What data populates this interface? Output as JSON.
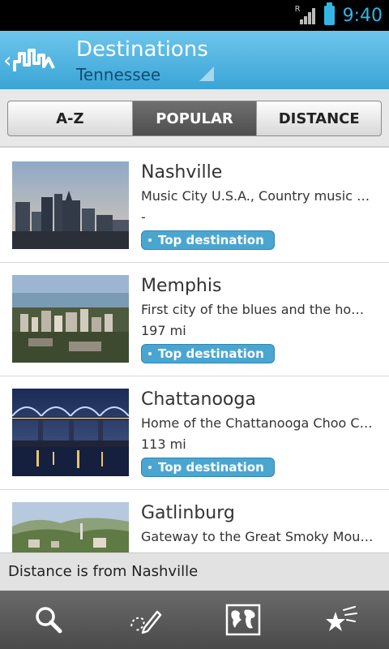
{
  "status_bar": {
    "roaming_indicator": "R",
    "time": "9:40",
    "icons": [
      "signal-icon",
      "battery-icon"
    ]
  },
  "header": {
    "title": "Destinations",
    "subtitle": "Tennessee",
    "icons": [
      "back-chevron-icon",
      "app-logo-icon",
      "dropdown-corner-icon"
    ]
  },
  "tabs": [
    {
      "label": "A-Z",
      "active": false
    },
    {
      "label": "POPULAR",
      "active": true
    },
    {
      "label": "DISTANCE",
      "active": false
    }
  ],
  "destinations": [
    {
      "name": "Nashville",
      "description": "Music City U.S.A., Country music c...",
      "distance": "-",
      "badge": "Top destination",
      "thumb": "nashville-skyline-image"
    },
    {
      "name": "Memphis",
      "description": "First city of the blues and the home...",
      "distance": "197 mi",
      "badge": "Top destination",
      "thumb": "memphis-city-image"
    },
    {
      "name": "Chattanooga",
      "description": "Home of the Chattanooga Choo Ch...",
      "distance": "113 mi",
      "badge": "Top destination",
      "thumb": "chattanooga-bridge-image"
    },
    {
      "name": "Gatlinburg",
      "description": "Gateway to the Great Smoky Moun...",
      "distance": "",
      "badge": "",
      "thumb": "gatlinburg-mountains-image"
    }
  ],
  "footer_note": "Distance is from Nashville",
  "bottom_nav": [
    {
      "icon": "search-icon"
    },
    {
      "icon": "route-pencil-icon"
    },
    {
      "icon": "world-map-icon"
    },
    {
      "icon": "favorites-stars-icon"
    }
  ],
  "colors": {
    "accent": "#33b5e5",
    "header_top": "#6ec6ec",
    "header_bottom": "#3aa4d6",
    "badge": "#4aa6d1",
    "active_tab": "#5a5a5a"
  }
}
